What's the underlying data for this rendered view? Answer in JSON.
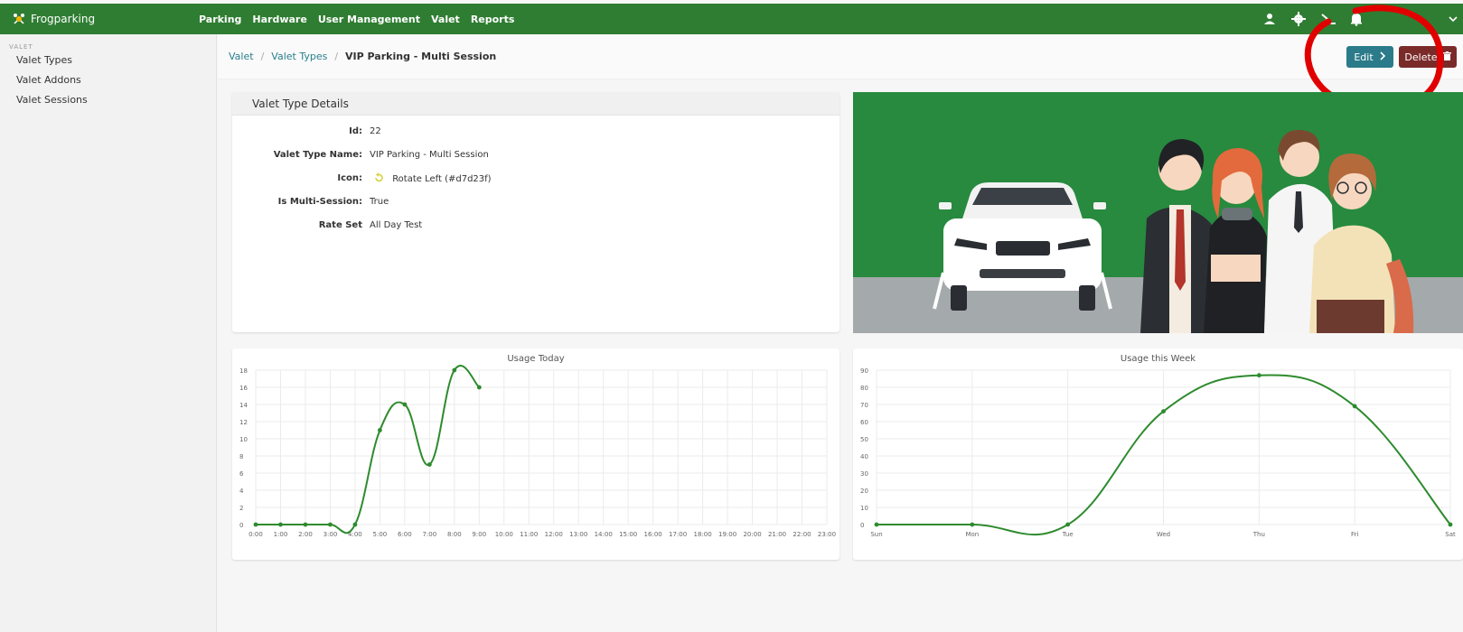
{
  "brand": {
    "name": "Frogparking"
  },
  "nav": {
    "items": [
      "Parking",
      "Hardware",
      "User Management",
      "Valet",
      "Reports"
    ]
  },
  "sidebar": {
    "section": "VALET",
    "items": [
      "Valet Types",
      "Valet Addons",
      "Valet Sessions"
    ]
  },
  "breadcrumb": {
    "root": "Valet",
    "middle": "Valet Types",
    "current": "VIP Parking - Multi Session"
  },
  "actions": {
    "edit": "Edit",
    "delete": "Delete"
  },
  "details": {
    "title": "Valet Type Details",
    "rows": [
      {
        "label": "Id:",
        "value": "22"
      },
      {
        "label": "Valet Type Name:",
        "value": "VIP Parking - Multi Session"
      },
      {
        "label": "Icon:",
        "value": "Rotate Left (#d7d23f)"
      },
      {
        "label": "Is Multi-Session:",
        "value": "True"
      },
      {
        "label": "Rate Set",
        "value": "All Day Test"
      }
    ],
    "icon_color": "#d7d23f"
  },
  "colors": {
    "brand": "#2f7d32",
    "series": "#2e8b2e",
    "edit": "#2b7b8a",
    "delete": "#7b2a2a",
    "annotation": "#e10000"
  },
  "chart_data": [
    {
      "type": "line",
      "title": "Usage Today",
      "categories": [
        "0:00",
        "1:00",
        "2:00",
        "3:00",
        "4:00",
        "5:00",
        "6:00",
        "7:00",
        "8:00",
        "9:00",
        "10:00",
        "11:00",
        "12:00",
        "13:00",
        "14:00",
        "15:00",
        "16:00",
        "17:00",
        "18:00",
        "19:00",
        "20:00",
        "21:00",
        "22:00",
        "23:00"
      ],
      "values": [
        0,
        0,
        0,
        0,
        0,
        11,
        14,
        7,
        18,
        16
      ],
      "ylim": [
        0,
        18
      ],
      "yticks": [
        0,
        2,
        4,
        6,
        8,
        10,
        12,
        14,
        16,
        18
      ],
      "grid": true
    },
    {
      "type": "line",
      "title": "Usage this Week",
      "categories": [
        "Sun",
        "Mon",
        "Tue",
        "Wed",
        "Thu",
        "Fri",
        "Sat"
      ],
      "values": [
        0,
        0,
        0,
        66,
        87,
        69,
        0
      ],
      "ylim": [
        0,
        90
      ],
      "yticks": [
        0,
        10,
        20,
        30,
        40,
        50,
        60,
        70,
        80,
        90
      ],
      "grid": true
    }
  ]
}
